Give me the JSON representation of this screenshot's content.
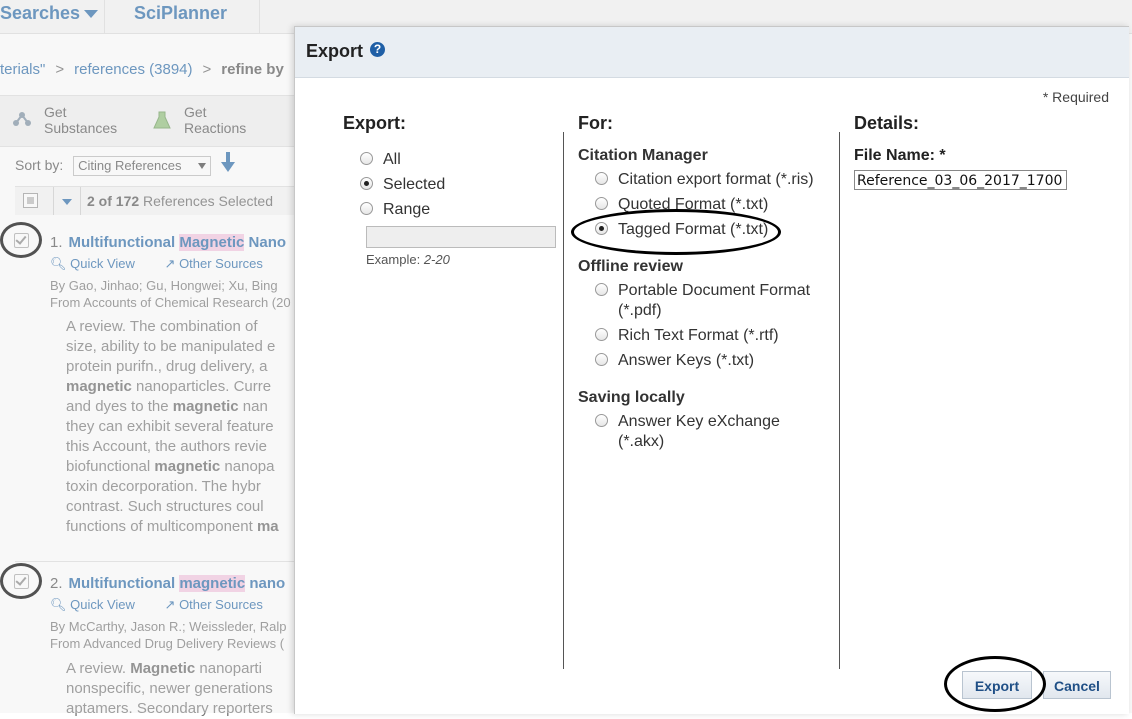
{
  "background": {
    "nav": {
      "searches_label": "Searches",
      "sciplanner_label": "SciPlanner"
    },
    "breadcrumb": {
      "part1": "terials\"",
      "part2": "references (3894)",
      "part3": "refine by"
    },
    "toolbar": {
      "get_substances": [
        "Get",
        "Substances"
      ],
      "get_reactions": [
        "Get",
        "Reactions"
      ]
    },
    "sort": {
      "label": "Sort by:",
      "value": "Citing References"
    },
    "selection": {
      "count_text": "2 of 172",
      "suffix": " References Selected"
    },
    "results": [
      {
        "num": "1.",
        "title_a": "Multifunctional ",
        "title_hl": "Magnetic",
        "title_b": " Nano",
        "quick_view": "Quick View",
        "other_sources": "Other Sources",
        "by": "By Gao, Jinhao; Gu, Hongwei; Xu, Bing",
        "from": "From Accounts of Chemical Research (20",
        "abstract": [
          [
            "A review.  The combination of ",
            "",
            ""
          ],
          [
            "size, ability to be manipulated e",
            "",
            ""
          ],
          [
            "protein purifn., drug delivery, a",
            "",
            ""
          ],
          [
            "",
            "magnetic",
            " nanoparticles.  Curre"
          ],
          [
            "and dyes to the ",
            "magnetic",
            " nan"
          ],
          [
            "they can exhibit several feature",
            "",
            ""
          ],
          [
            "this Account, the authors revie",
            "",
            ""
          ],
          [
            "biofunctional ",
            "magnetic",
            " nanopa"
          ],
          [
            "toxin decorporation.  The hybr",
            "",
            ""
          ],
          [
            "contrast.  Such structures coul",
            "",
            ""
          ],
          [
            "functions of multicomponent ",
            "ma",
            ""
          ]
        ]
      },
      {
        "num": "2.",
        "title_a": "Multifunctional ",
        "title_hl": "magnetic",
        "title_b": " nano",
        "quick_view": "Quick View",
        "other_sources": "Other Sources",
        "by": "By McCarthy, Jason R.; Weissleder, Ralp",
        "from": "From Advanced Drug Delivery Reviews (",
        "abstract": [
          [
            "A review.  ",
            "Magnetic",
            " nanoparti"
          ],
          [
            "nonspecific, newer generations",
            "",
            ""
          ],
          [
            "aptamers.  Secondary reporters",
            "",
            ""
          ]
        ]
      }
    ]
  },
  "dialog": {
    "title": "Export",
    "required_note": "* Required",
    "export_col": {
      "heading": "Export:",
      "options": [
        {
          "label": "All",
          "selected": false
        },
        {
          "label": "Selected",
          "selected": true
        },
        {
          "label": "Range",
          "selected": false
        }
      ],
      "example_prefix": "Example: ",
      "example_value": "2-20"
    },
    "for_col": {
      "heading": "For:",
      "sections": [
        {
          "title": "Citation Manager",
          "options": [
            {
              "label": "Citation export format (*.ris)",
              "selected": false
            },
            {
              "label": "Quoted Format (*.txt)",
              "selected": false
            },
            {
              "label": "Tagged Format (*.txt)",
              "selected": true
            }
          ]
        },
        {
          "title": "Offline review",
          "options": [
            {
              "label": "Portable Document Format\n(*.pdf)",
              "selected": false
            },
            {
              "label": "Rich Text Format (*.rtf)",
              "selected": false
            },
            {
              "label": "Answer Keys (*.txt)",
              "selected": false
            }
          ]
        },
        {
          "title": "Saving locally",
          "options": [
            {
              "label": "Answer Key eXchange\n(*.akx)",
              "selected": false
            }
          ]
        }
      ]
    },
    "details_col": {
      "heading": "Details:",
      "file_name_label": "File Name: *",
      "file_name_value": "Reference_03_06_2017_1700"
    },
    "buttons": {
      "export": "Export",
      "cancel": "Cancel"
    },
    "colors": {
      "header_bg": "#e9eef3",
      "link": "#2a6aa8",
      "button_text": "#1f4f86",
      "help_icon": "#1f5fa6"
    }
  }
}
